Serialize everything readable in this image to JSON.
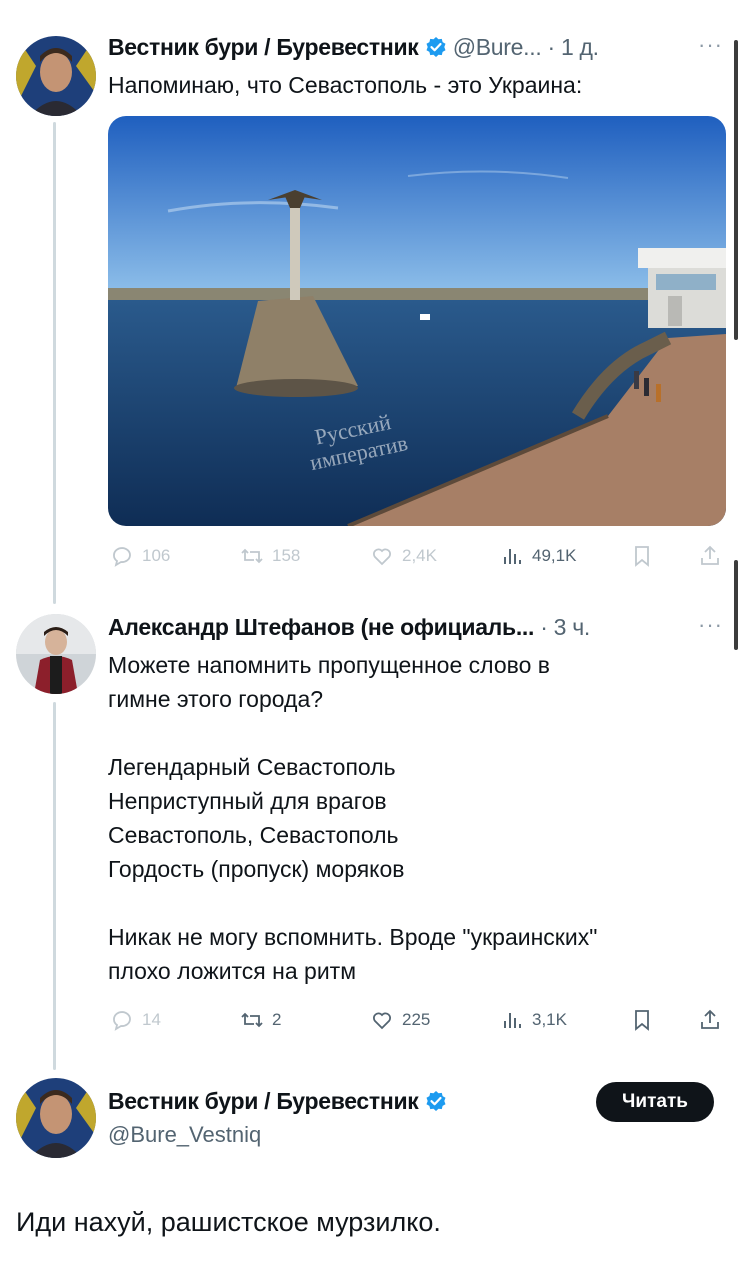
{
  "tweet1": {
    "author_name": "Вестник бури / Буревестник",
    "handle_time": "@Bure... · 1 д.",
    "text": "Напоминаю, что Севастополь - это Украина:",
    "image_watermark": "Русский\nимператив",
    "stats": {
      "replies": "106",
      "retweets": "158",
      "likes": "2,4K",
      "views": "49,1K"
    }
  },
  "tweet2": {
    "author_name": "Александр Штефанов (не официаль...",
    "time": "· 3 ч.",
    "text": "Можете напомнить пропущенное слово в\nгимне этого города?\n\nЛегендарный Севастополь\nНеприступный для врагов\nСевастополь, Севастополь\nГордость (пропуск) моряков\n\nНикак не могу вспомнить. Вроде \"украинских\"\nплохо ложится на ритм",
    "stats": {
      "replies": "14",
      "retweets": "2",
      "likes": "225",
      "views": "3,1K"
    }
  },
  "main_tweet": {
    "author_name": "Вестник бури / Буревестник",
    "handle": "@Bure_Vestniq",
    "follow_label": "Читать",
    "text": "Иди нахуй, рашистское мурзилко."
  },
  "colors": {
    "verified": "#1d9bf0",
    "muted": "#536471",
    "follow_bg": "#0f1419"
  }
}
